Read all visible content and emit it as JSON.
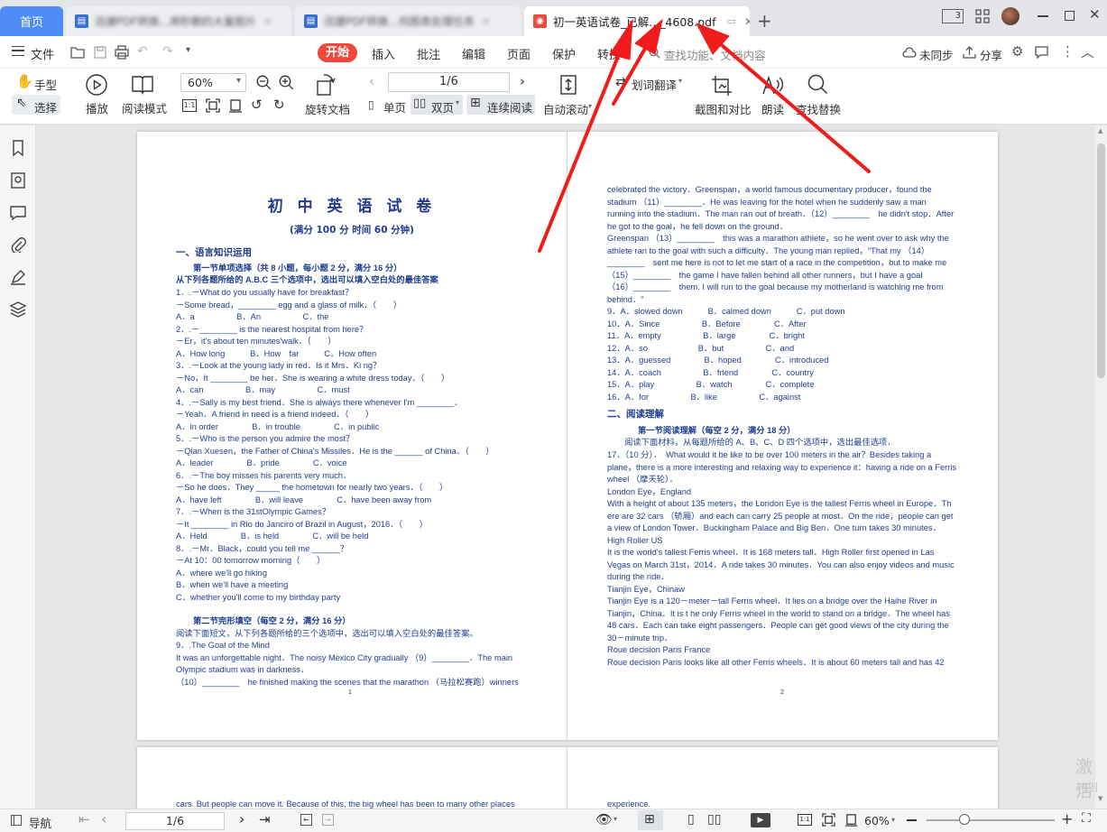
{
  "tabs": {
    "home": "首页",
    "tab1": "迅捷PDF转换...用秒删的大量图片",
    "tab2": "迅捷PDF转换...何图表处理任务",
    "active": "初一英语试卷_已解..._4608.pdf",
    "new_tab": "+"
  },
  "window": {
    "page_badge": "3"
  },
  "menu": {
    "file": "文件",
    "tabs": [
      "开始",
      "插入",
      "批注",
      "编辑",
      "页面",
      "保护",
      "转换"
    ],
    "search_placeholder": "查找功能、文档内容",
    "sync": "未同步",
    "share": "分享"
  },
  "toolbar": {
    "hand": "手型",
    "select": "选择",
    "play": "播放",
    "read_mode": "阅读模式",
    "zoom": "60%",
    "rotate": "旋转文档",
    "page_input": "1/6",
    "single": "单页",
    "double": "双页",
    "continuous": "连续阅读",
    "autoscroll": "自动滚动",
    "translate": "划词翻译",
    "screenshot": "截图和对比",
    "read_aloud": "朗读",
    "find_replace": "查找替换"
  },
  "doc": {
    "title": "初 中 英 语 试 卷",
    "subtitle": "(满分 100 分 时间 60 分钟)",
    "sec1": "一、语言知识运用",
    "sec1_1": "第一节单项选择（共 8 小题，每小题 2 分，满分 16 分）",
    "sec1_1_inst": "从下列各题所给的 A.B.C 三个选项中，选出可以填入空白处的最佳答案",
    "left_lines": [
      "1．.－What do you usually have for breakfast？",
      "－Some bread，________ egg and a glass of milk．（　　）",
      "A．a　　　　　B．An　　　　　C．the",
      "2．.－________ is the nearest hospital from here？",
      "－Er，it's about ten minutes'walk．（　　）",
      "A．How long　　　B．How　far　　　C．How often",
      "3．.－Look at the young lady in red．Is it Mrs．Ki ng？",
      "－No，It ________ be her．She is wearing a white dress today．（　　）",
      "A．can　　　　　B．may　　　　　C．must",
      "4．.－Sally is my best friend．She is always there whenever I'm ________．",
      "－Yeah．A friend in need is a friend indeed．（　　）",
      "A．in order　　　　B．in trouble　　　　C．in public",
      "5．.－Who is the person you admire the most？",
      "－Qian Xuesen，the Father of China's Missiles．He is the ______ of China．（　　）",
      "A．leader　　　　B．pride　　　　C．voice",
      "6．.－The boy misses his parents very much．",
      "－So he does．They _____ the hometown for nearly two years．（　　）",
      "A．have left　　　　B．will leave　　　　C．have been away from",
      "7．.－When is the 31stOlympic Games？",
      "－It ________ in Rio do Janciro of Brazil in August，2016．（　　）",
      "A．Held　　　　B．is held　　　　C．will be held",
      "8．.－Mr．Black，could you tell me ______？",
      "－At 10：00 tomorrow morning（　　）",
      "A．where we'll go hiking",
      "B．when we'll have a meeting",
      "C．whether you'll come to my birthday party"
    ],
    "sec1_2": "第二节完形填空（每空 2 分，满分 16 分）",
    "sec1_2_inst": "阅读下面短文，从下列各题所给的三个选项中，选出可以填入空白处的最佳答案。",
    "left_lines2": [
      "9．.The Goal of the Mind",
      "It was an unforgettable night．The noisy Mexico City gradually （9）________．The main",
      "Olympic stadium was in darkness．",
      "（10）________　he finished making the scenes that the marathon （马拉松赛跑）winners"
    ],
    "page1_num": "1",
    "right_lines": [
      "celebrated the victory．Greenspan，a world famous documentary producer，found the",
      "stadium （11）________．He was leaving for the hotel when he suddenly saw a man",
      "running into the stadium．The man ran out of breath．（12）________　he didn't stop．After",
      "he got to the goal，he fell down on the ground．",
      "Greenspan （13）________　this was a marathon athlete，so he went over to ask why the",
      "athlete ran to the goal with such a difficulty．The young man replied，\"That my （14）",
      "________　sent me here is not to let me start of a race in the competition，but to make me",
      "（15）________　the game I have fallen behind all other runners，but I have a goal",
      "（16）________　them. I will run to the goal because my motherland is watching me from",
      "behind．\"",
      "9．A．slowed down　　　B．calmed down　　　C．put down",
      "10．A．Since　　　　　B．Before　　　　C．After",
      "11．A．empty　　　　　B．large　　　　C．bright",
      "12．A．so　　　　　　B．but　　　　　C．and",
      "13．A．guessed　　　　B．hoped　　　　C．introduced",
      "14．A．coach　　　　　B．friend　　　　C．country",
      "15．A．play　　　　　B．watch　　　　C．complete",
      "16．A．for　　　　　B．like　　　　　C．against"
    ],
    "sec2": "二、阅读理解",
    "sec2_1": "第一节阅读理解（每空 2 分，满分 18 分）",
    "sec2_1_inst": "阅读下面材料，从每题所给的 A、B、C、D 四个选项中，选出最佳选项．",
    "right_lines2": [
      "17．（10 分）．　What would it be like to be over 100 meters in the air？Besides taking a",
      "plane，there is a more interesting and relaxing way to experience it：having a ride on a Ferris",
      "wheel （摩天轮）．",
      "London Eye，England",
      "With a height of about 135 meters，the London Eye is the tallest Ferris wheel in Europe．Th",
      "ere are 32 cars （轿厢）and each can carry 25 people at most．On the ride，people can get",
      "a view of London Tower．Buckingham Palace and Big Ben．One turn takes 30 minutes．",
      "High Roller US",
      "It is the world's tallest Ferris wheel．It is 168 meters tall．High Roller first opened in Las",
      "Vegas on March 31st，2014．A ride takes 30 minutes．You can also enjoy videos and music",
      "during the ride．",
      "Tianjin Eye，Chinaw",
      "Tianjin Eye is a 120－meter－tall Ferris wheel．It lies on a bridge over the Haihe River in",
      "Tianjin，China．It is t he only Ferris wheel in the world to stand on a bridge．The wheel has",
      "48 cars．Each can take eight passengers．People can get good views of the city during the",
      "30－minute trip．",
      "Roue decision Paris France",
      "Roue decision Paris looks like all other Ferris wheels．It is about 60 meters tall and has 42"
    ],
    "page2_num": "2",
    "next_left": "cars. But people can move it. Because of this, the big wheel has been to many other places",
    "next_right": "experience."
  },
  "watermark": {
    "line1": "激活",
    "line2": "转到"
  },
  "status": {
    "nav": "导航",
    "page": "1/6",
    "zoom": "60%"
  },
  "colors": {
    "home_tab": "#4e8cf7",
    "start_button": "#f5463b",
    "arrow": "#f01b1b",
    "doc_text": "#1f3f8f"
  }
}
